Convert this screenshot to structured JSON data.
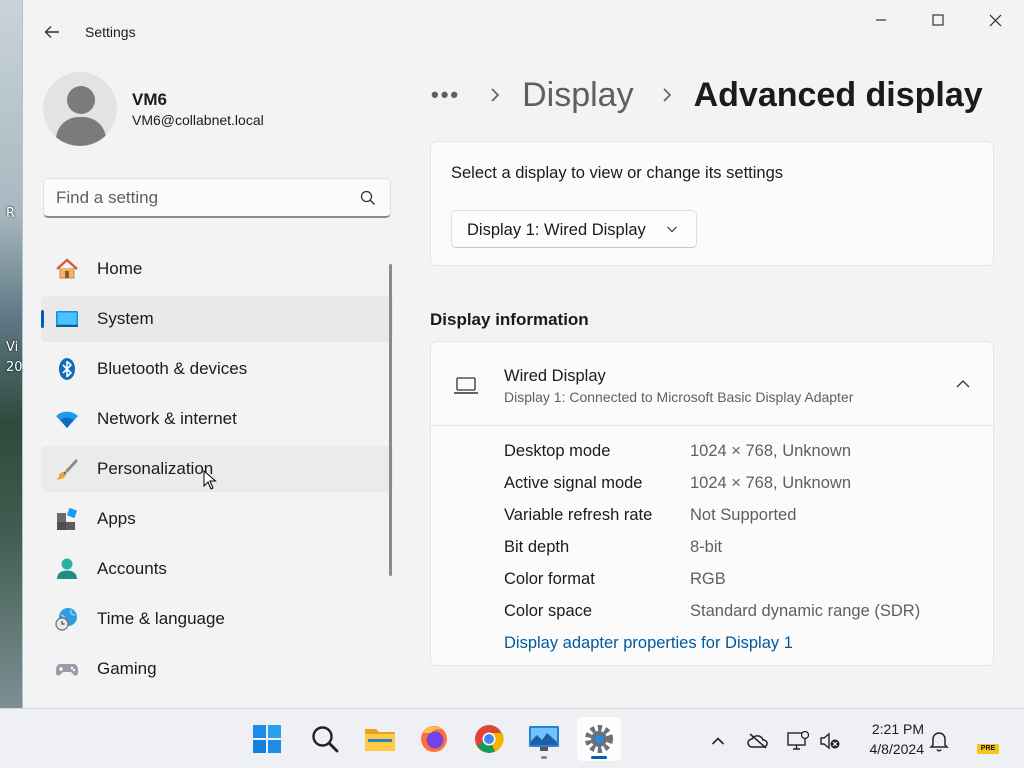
{
  "desktop": {
    "snippets": [
      "R",
      "Vi",
      "20"
    ]
  },
  "window": {
    "title": "Settings"
  },
  "profile": {
    "name": "VM6",
    "email": "VM6@collabnet.local"
  },
  "search": {
    "placeholder": "Find a setting",
    "value": ""
  },
  "nav": {
    "items": [
      {
        "label": "Home",
        "icon": "home-icon"
      },
      {
        "label": "System",
        "icon": "system-icon",
        "selected": true
      },
      {
        "label": "Bluetooth & devices",
        "icon": "bluetooth-icon"
      },
      {
        "label": "Network & internet",
        "icon": "wifi-icon"
      },
      {
        "label": "Personalization",
        "icon": "brush-icon",
        "hover": true
      },
      {
        "label": "Apps",
        "icon": "apps-icon"
      },
      {
        "label": "Accounts",
        "icon": "person-icon"
      },
      {
        "label": "Time & language",
        "icon": "globe-clock-icon"
      },
      {
        "label": "Gaming",
        "icon": "gamepad-icon"
      }
    ]
  },
  "breadcrumb": {
    "more": "•••",
    "parent": "Display",
    "current": "Advanced display"
  },
  "display_select": {
    "label": "Select a display to view or change its settings",
    "selected": "Display 1: Wired Display"
  },
  "display_info": {
    "section_title": "Display information",
    "name": "Wired Display",
    "subtitle": "Display 1: Connected to Microsoft Basic Display Adapter",
    "rows": [
      {
        "key": "Desktop mode",
        "value": "1024 × 768, Unknown"
      },
      {
        "key": "Active signal mode",
        "value": "1024 × 768, Unknown"
      },
      {
        "key": "Variable refresh rate",
        "value": "Not Supported"
      },
      {
        "key": "Bit depth",
        "value": "8-bit"
      },
      {
        "key": "Color format",
        "value": "RGB"
      },
      {
        "key": "Color space",
        "value": "Standard dynamic range (SDR)"
      }
    ],
    "link": "Display adapter properties for Display 1"
  },
  "taskbar": {
    "apps": [
      "start-icon",
      "search-icon",
      "file-explorer-icon",
      "firefox-icon",
      "chrome-icon",
      "monitor-app-icon",
      "settings-icon"
    ],
    "clock": {
      "time": "2:21 PM",
      "date": "4/8/2024"
    },
    "badge": "PRE"
  },
  "colors": {
    "accent": "#005fb8",
    "link": "#005a9e",
    "window_bg": "#f3f3f3",
    "card_bg": "#fbfbfb"
  }
}
